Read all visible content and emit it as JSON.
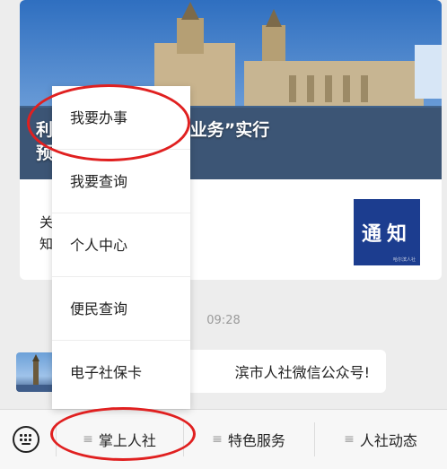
{
  "article_card": {
    "banner_title_line1": "利·服务大厅“社保卡业务”实行",
    "banner_title_line2": "预",
    "news_title_line1": "关·网上办“”预约办”的通",
    "news_title_line2": "知",
    "thumbnail_text": "通知",
    "thumbnail_caption": "哈尔滨人社"
  },
  "chat": {
    "timestamp": "09:28",
    "message": "滨市人社微信公众号!"
  },
  "popup_menu": {
    "items": [
      "我要办事",
      "我要查询",
      "个人中心",
      "便民查询",
      "电子社保卡"
    ]
  },
  "bottom_menu": {
    "items": [
      "掌上人社",
      "特色服务",
      "人社动态"
    ],
    "menu_lines_glyph": "≡"
  },
  "icons": {
    "keyboard": "keyboard-icon",
    "menu": "menu-lines-icon"
  },
  "colors": {
    "highlight_ring": "#e02020",
    "thumbnail_bg": "#1c3d8f"
  }
}
